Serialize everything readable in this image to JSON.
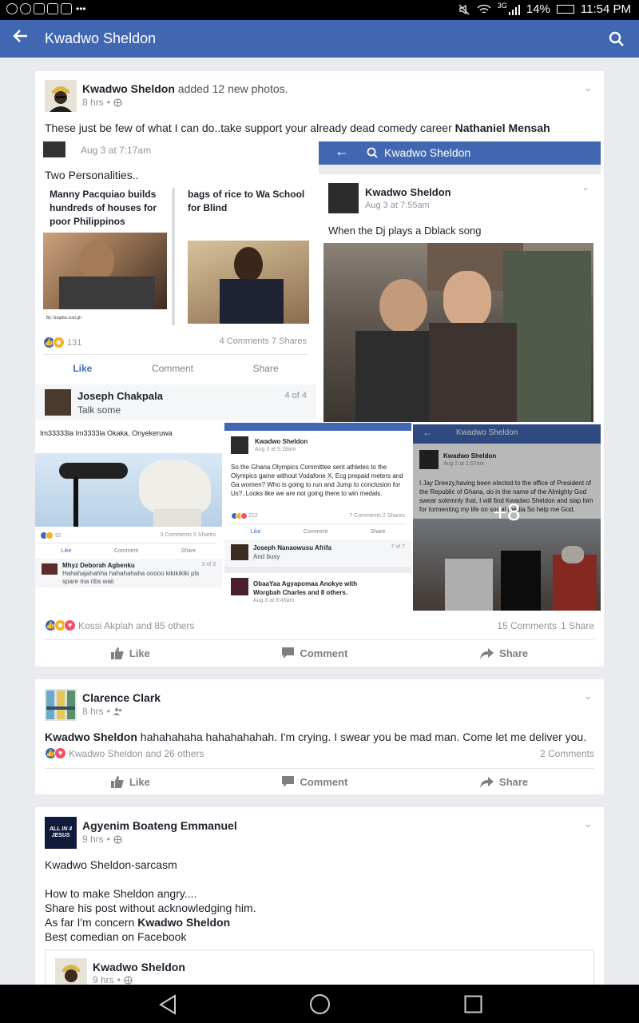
{
  "status": {
    "battery_pct": "14%",
    "time": "11:54 PM",
    "network": "3G"
  },
  "appbar": {
    "title": "Kwadwo Sheldon"
  },
  "post1": {
    "author": "Kwadwo Sheldon",
    "action": " added 12 new photos.",
    "time": "8 hrs",
    "text": "These just be few of what I can do..take support your already dead  comedy career ",
    "tag": "Nathaniel Mensah",
    "reactions": "Kossi Akplah and 85 others",
    "comments": "15 Comments",
    "shares": "1 Share",
    "like": "Like",
    "comment": "Comment",
    "share": "Share",
    "photo1": {
      "date": "Aug 3 at 7:17am",
      "caption": "Two Personalities..",
      "left": "Manny Pacquiao builds hundreds of houses for poor Philippinos",
      "right": "bags of rice to Wa School for Blind",
      "credit": "By: Graphic.com.gh",
      "rx": "131",
      "stats": "4 Comments 7 Shares",
      "like": "Like",
      "comment": "Comment",
      "share": "Share",
      "commenter": "Joseph Chakpala",
      "comment_text": "Talk some",
      "page": "4 of 4"
    },
    "photo2": {
      "bar": "Kwadwo Sheldon",
      "author": "Kwadwo Sheldon",
      "date": "Aug 3 at 7:55am",
      "text": "When the Dj plays a Dblack song"
    },
    "photo3": {
      "text": "Im33333la Im3333la Okaka, Onyekeruwa",
      "rx": "92",
      "stats": "3 Comments 5 Shares",
      "like": "Like",
      "comment": "Comment",
      "share": "Share",
      "commenter": "Mhyz Deborah Agbenku",
      "comment_text": "Hahahajahahha hahahahaha ooooo kikikikiki pls spare ma ribs waii",
      "page": "3 of 3"
    },
    "photo4": {
      "author": "Kwadwo Sheldon",
      "date": "Aug 3 at 9:18am",
      "text": "So the Ghana Olympics Committee sent athletes to the Olympics game without Vodafone X, Ecg prepaid meters and Ga women? Who is going to run and Jump to conclusion for Us?..Looks like we are not going there to win medals.",
      "rx": "212",
      "stats": "7 Comments 2 Shares",
      "like": "Like",
      "comment": "Comment",
      "share": "Share",
      "commenter": "Joseph Nanaowusu Afrifa",
      "comment_text": "And busy",
      "page": "7 of 7",
      "next": "ObaaYaa Agyapomaa Anokye with Worgbah Charles and 8 others.",
      "next_date": "Aug 3 at 8:45am"
    },
    "photo5": {
      "bar": "Kwadwo Sheldon",
      "author": "Kwadwo Sheldon",
      "date": "Aug 2 at 1:57am",
      "text": "I Jay Dreezy,having been elected to the office of President of the Republic of Ghana, do in the name of the Almighty God swear solemnly that, I will find Kwadwo Sheldon and slap him for tormenting my life on social media.So help me God.",
      "more": "+8"
    }
  },
  "post2": {
    "author": "Clarence Clark",
    "time": "8 hrs",
    "tag": "Kwadwo Sheldon",
    "text": " hahahahaha hahahahahah. I'm crying. I swear you be mad man. Come let me deliver you.",
    "reactions": "Kwadwo Sheldon and 26 others",
    "comments": "2 Comments",
    "like": "Like",
    "comment": "Comment",
    "share": "Share"
  },
  "post3": {
    "author": "Agyenim Boateng Emmanuel",
    "time": "9 hrs",
    "avatar_text": "ALL IN 4 JESUS",
    "line1": "Kwadwo Sheldon-sarcasm",
    "line2": "How to make Sheldon angry....",
    "line3": "Share his post without acknowledging him.",
    "line4a": "As far I'm concern ",
    "line4b": "Kwadwo Sheldon",
    "line5": "Best comedian on Facebook",
    "shared_author": "Kwadwo Sheldon",
    "shared_time": "9 hrs"
  },
  "colors": {
    "fb_blue": "#4267b2",
    "background": "#e9ebee"
  }
}
